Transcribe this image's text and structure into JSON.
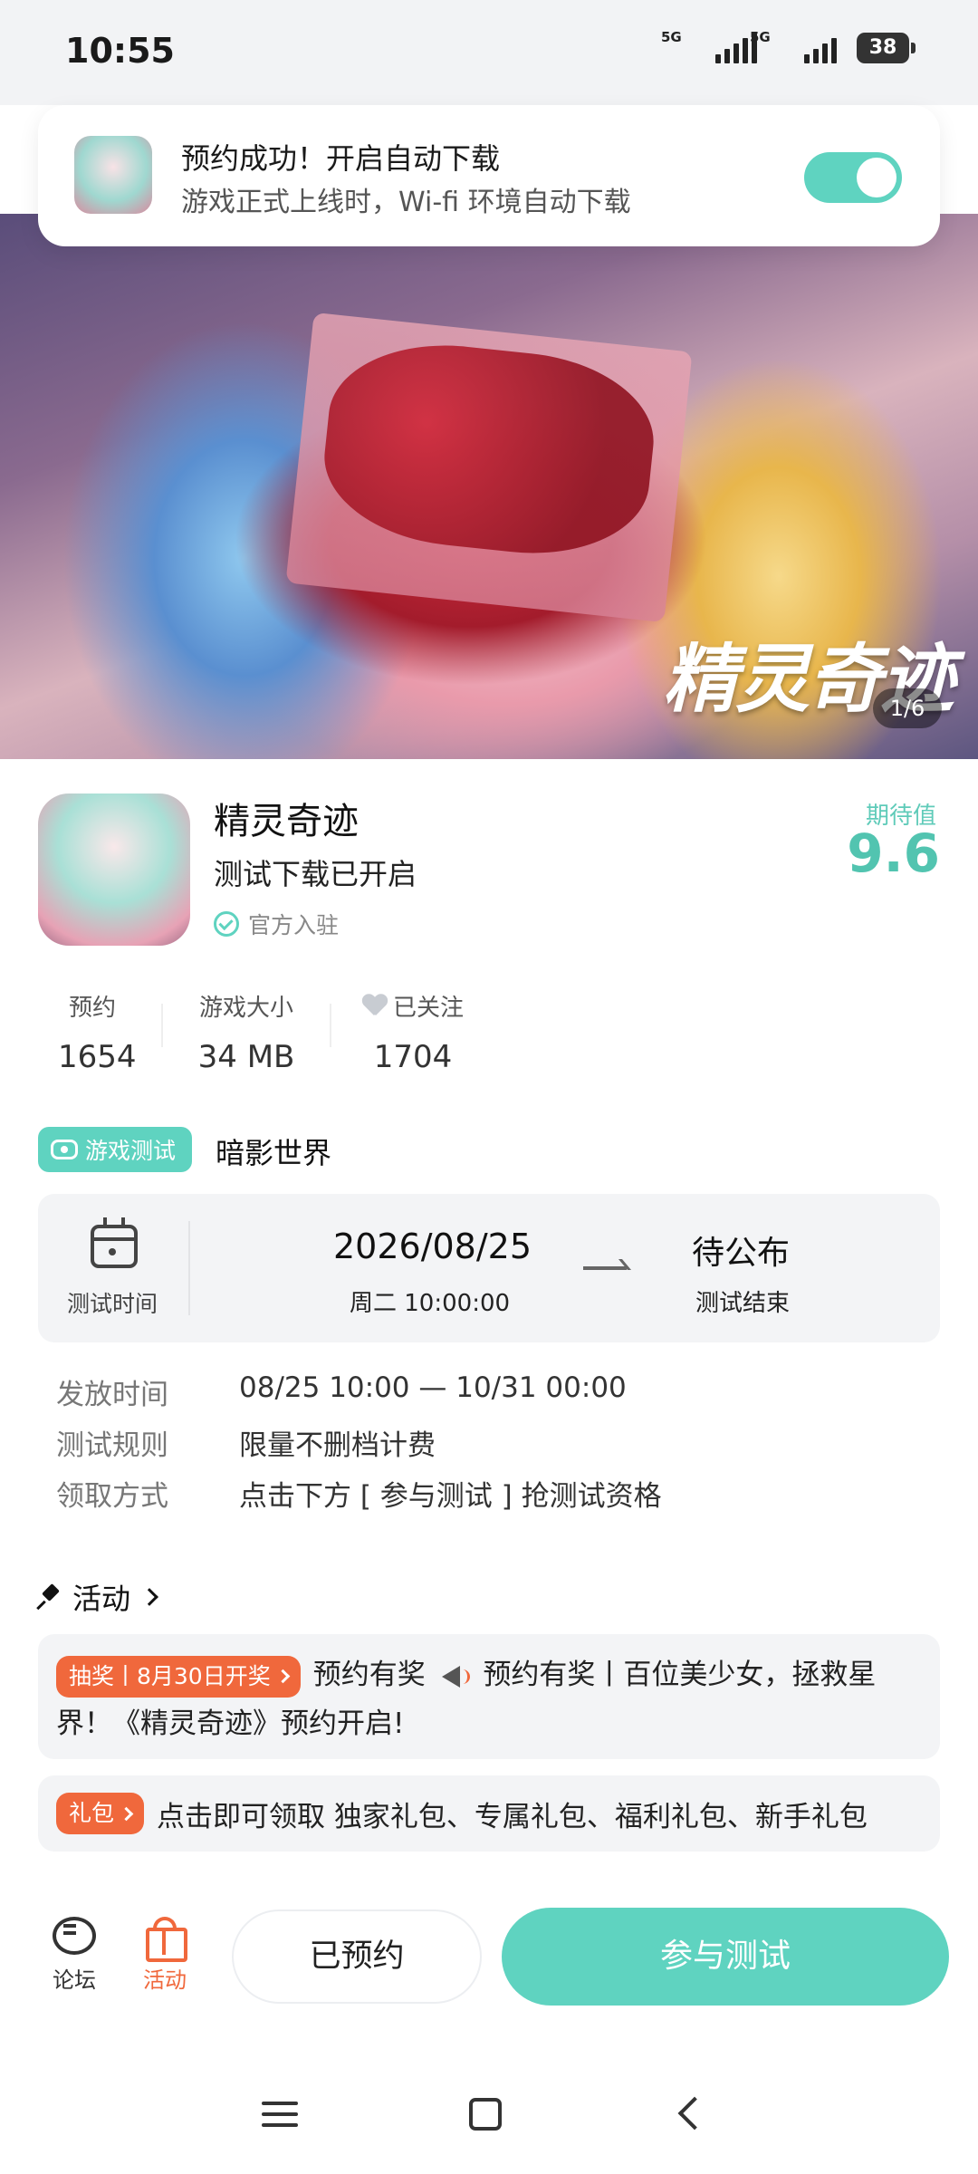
{
  "status_bar": {
    "time": "10:55",
    "network_1": "5G",
    "network_2": "5G",
    "battery": "38"
  },
  "toast": {
    "title": "预约成功！开启自动下载",
    "subtitle": "游戏正式上线时，Wi-fi 环境自动下载",
    "toggle_on": true
  },
  "banner": {
    "title": "精灵奇迹",
    "counter": "1/6"
  },
  "game": {
    "name": "精灵奇迹",
    "status": "测试下载已开启",
    "official": "官方入驻",
    "expect_label": "期待值",
    "expect_value": "9.6"
  },
  "stats": [
    {
      "label": "预约",
      "value": "1654"
    },
    {
      "label": "游戏大小",
      "value": "34 MB"
    },
    {
      "label": "已关注",
      "value": "1704"
    }
  ],
  "test": {
    "tag": "游戏测试",
    "world": "暗影世界",
    "time_label": "测试时间",
    "start_date": "2026/08/25",
    "start_time": "周二  10:00:00",
    "end_date": "待公布",
    "end_label": "测试结束"
  },
  "info": [
    {
      "key": "发放时间",
      "value": "08/25 10:00 — 10/31 00:00"
    },
    {
      "key": "测试规则",
      "value": "限量不删档计费"
    },
    {
      "key": "领取方式",
      "value": "点击下方 [ 参与测试 ] 抢测试资格"
    }
  ],
  "activity": {
    "title": "活动",
    "item1_badge": "抽奖丨8月30日开奖",
    "item1_text_a": "预约有奖",
    "item1_text_b": "预约有奖丨百位美少女，拯救星界！《精灵奇迹》预约开启!",
    "item2_badge": "礼包",
    "item2_text": "点击即可领取 独家礼包、专属礼包、福利礼包、新手礼包"
  },
  "bottom_bar": {
    "forum": "论坛",
    "activity": "活动",
    "reserved": "已预约",
    "join": "参与测试"
  },
  "colors": {
    "accent": "#5fd3c0",
    "orange": "#f0683c"
  }
}
